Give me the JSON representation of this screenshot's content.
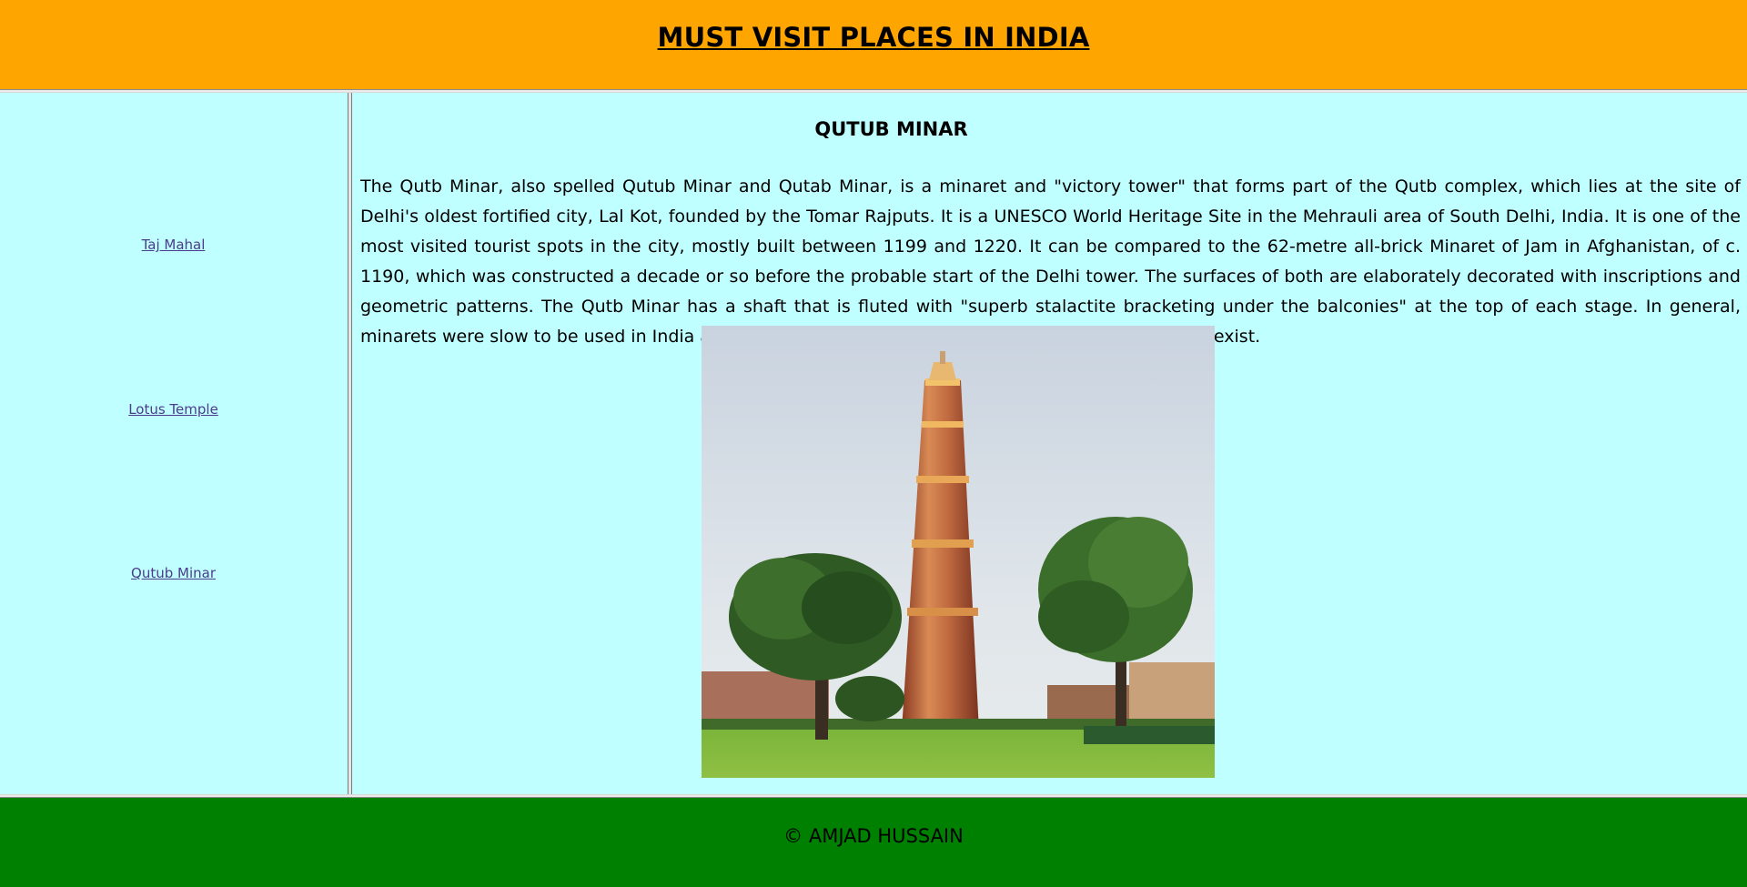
{
  "header": {
    "title": "MUST VISIT PLACES IN INDIA",
    "background": "#ffa500"
  },
  "sidebar": {
    "background": "#c0ffff",
    "links": [
      {
        "label": "Taj Mahal"
      },
      {
        "label": "Lotus Temple"
      },
      {
        "label": "Qutub Minar"
      }
    ]
  },
  "main": {
    "heading": "QUTUB MINAR",
    "paragraph": "The Qutb Minar, also spelled Qutub Minar and Qutab Minar, is a minaret and \"victory tower\" that forms part of the Qutb complex, which lies at the site of Delhi's oldest fortified city, Lal Kot, founded by the Tomar Rajputs. It is a UNESCO World Heritage Site in the Mehrauli area of South Delhi, India. It is one of the most visited tourist spots in the city, mostly built between 1199 and 1220. It can be compared to the 62-metre all-brick Minaret of Jam in Afghanistan, of c. 1190, which was constructed a decade or so before the probable start of the Delhi tower. The surfaces of both are elaborately decorated with inscriptions and geometric patterns. The Qutb Minar has a shaft that is fluted with \"superb stalactite bracketing under the balconies\" at the top of each stage. In general, minarets were slow to be used in India and are often detached from the main mosque where they exist.",
    "image_subject": "qutub-minar-photo"
  },
  "footer": {
    "text": "© AMJAD HUSSAIN",
    "background": "#008000"
  }
}
